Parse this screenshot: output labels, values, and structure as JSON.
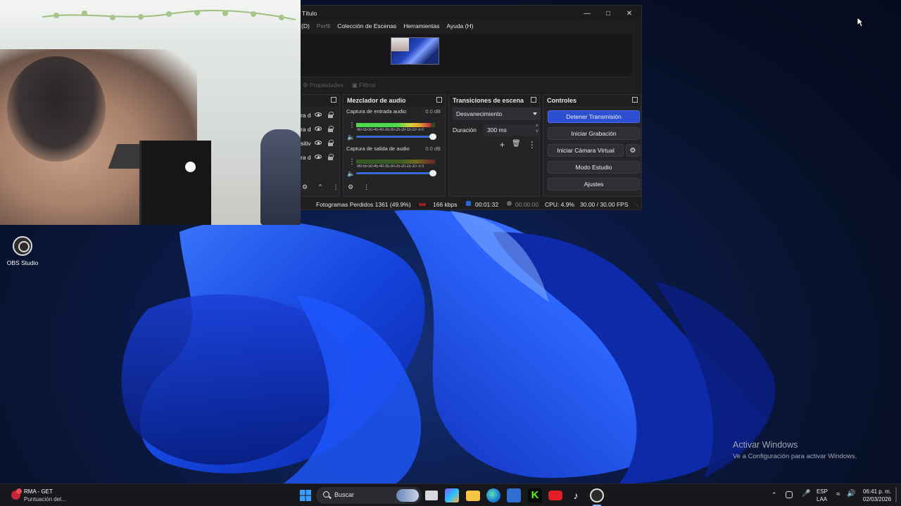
{
  "desktop": {
    "icon_label": "OBS Studio",
    "activate_title": "Activar Windows",
    "activate_subtitle": "Ve a Configuración para activar Windows."
  },
  "obs": {
    "window_title": "Título",
    "menu": [
      "(D)",
      "Perfil",
      "Colección de Escenas",
      "Herramientas",
      "Ayuda (H)"
    ],
    "propbar": {
      "properties": "Propiedades",
      "filters": "Filtros"
    },
    "sources": {
      "items": [
        {
          "label": "ra d"
        },
        {
          "label": "ra d"
        },
        {
          "label": "sitiv"
        },
        {
          "label": "ra d"
        }
      ]
    },
    "mixer": {
      "title": "Mezclador de audio",
      "tracks": [
        {
          "name": "Captura de entrada audio",
          "db": "0.0 dB",
          "level": 0.95,
          "scale": "-60-55-50-45-40-35-30-25-20-15-10 -5 0"
        },
        {
          "name": "Captura de salida de audio",
          "db": "0.0 dB",
          "level": 0.0,
          "scale": "-60-55-50-45-40-35-30-25-20-15-10 -5 0"
        }
      ]
    },
    "transitions": {
      "title": "Transiciones de escena",
      "selected": "Desvanecimiento",
      "duration_label": "Duración",
      "duration_value": "300 ms"
    },
    "controls": {
      "title": "Controles",
      "stop_stream": "Detener Transmisión",
      "start_recording": "Iniciar Grabación",
      "start_virtual_cam": "Iniciar Cámara Virtual",
      "studio_mode": "Modo Estudio",
      "settings": "Ajustes"
    },
    "status": {
      "dropped_frames": "Fotogramas Perdidos 1361 (49.9%)",
      "bitrate": "166 kbps",
      "stream_time": "00:01:32",
      "rec_time": "00:00:00",
      "cpu": "CPU: 4.9%",
      "fps": "30.00 / 30.00 FPS"
    }
  },
  "taskbar": {
    "app_title": "RMA - GET",
    "app_subtitle": "Puntuación del...",
    "search_placeholder": "Buscar",
    "lang_top": "ESP",
    "lang_bottom": "LAA",
    "time": "06:41 p. m.",
    "date": "02/03/2026"
  },
  "colors": {
    "accent_blue": "#2b4fd0",
    "meter_green": "#4ed84b",
    "stream_red": "#c8283a"
  }
}
